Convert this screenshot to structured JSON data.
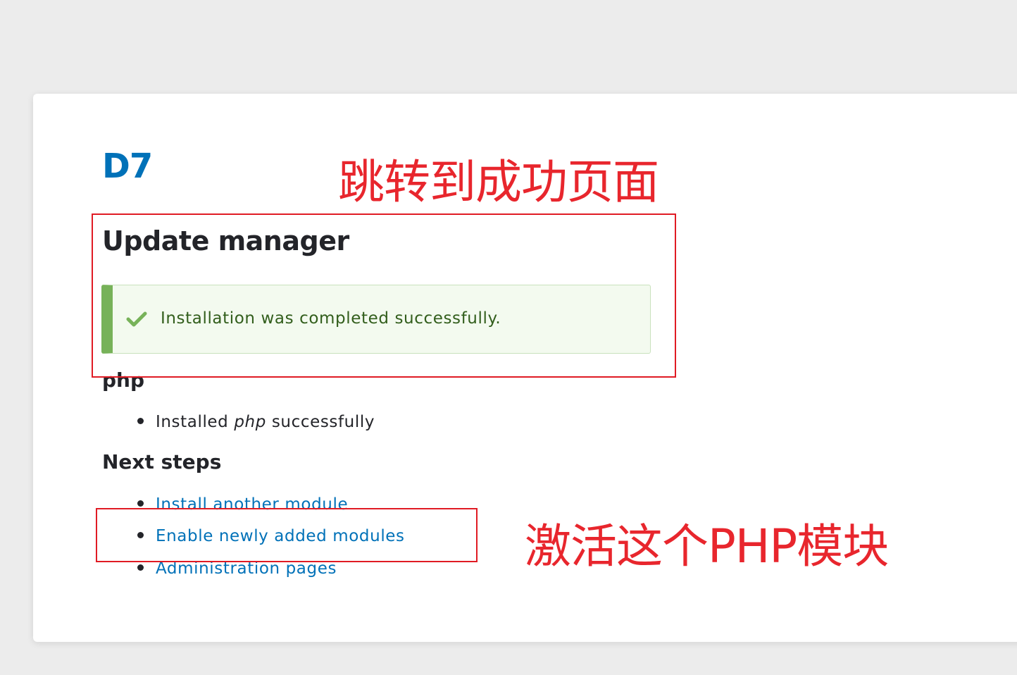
{
  "site": {
    "name": "D7"
  },
  "page": {
    "title": "Update manager"
  },
  "status_message": {
    "text": "Installation was completed successfully.",
    "icon": "check-icon",
    "accent_color": "#77b259"
  },
  "module_section": {
    "heading": "php",
    "result": {
      "prefix": "Installed",
      "module": "php",
      "suffix": "successfully"
    }
  },
  "next_steps": {
    "heading": "Next steps",
    "links": [
      {
        "label": "Install another module"
      },
      {
        "label": "Enable newly added modules"
      },
      {
        "label": "Administration pages"
      }
    ]
  },
  "annotations": {
    "success_page_label": "跳转到成功页面",
    "activate_module_label": "激活这个PHP模块",
    "color": "#e01b24"
  }
}
